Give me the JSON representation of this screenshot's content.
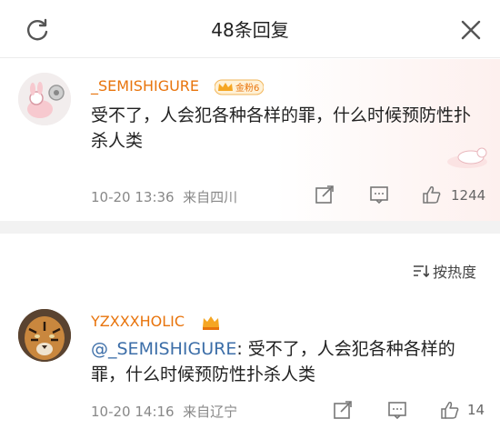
{
  "header": {
    "title": "48条回复"
  },
  "comments": [
    {
      "username": "_SEMISHIGURE",
      "badge_label": "金粉6",
      "text": "受不了，人会犯各种各样的罪，什么时候预防性扑杀人类",
      "timestamp": "10-20 13:36",
      "location": "来自四川",
      "likes": "1244"
    },
    {
      "username": "YZXXXHOLIC",
      "mention": "@_SEMISHIGURE",
      "text": ": 受不了，人会犯各种各样的罪，什么时候预防性扑杀人类",
      "timestamp": "10-20 14:16",
      "location": "来自辽宁",
      "likes": "14"
    }
  ],
  "sort": {
    "label": "按热度"
  },
  "colors": {
    "username": "#e8740c",
    "mention": "#3c6ea8",
    "meta": "#888888"
  },
  "icons": [
    "refresh-icon",
    "close-icon",
    "share-icon",
    "comment-icon",
    "like-icon",
    "sort-icon",
    "vip-crown-icon"
  ]
}
